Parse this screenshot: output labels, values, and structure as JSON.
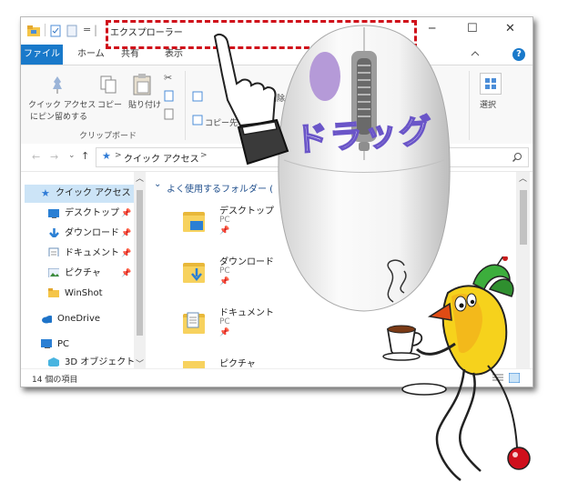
{
  "window": {
    "title": "エクスプローラー",
    "controls": {
      "minimize": "─",
      "maximize": "☐",
      "close": "✕"
    }
  },
  "quick_access_toolbar": {
    "dropdown": "="
  },
  "ribbon": {
    "tabs": [
      {
        "label": "ファイル"
      },
      {
        "label": "ホーム"
      },
      {
        "label": "共有"
      },
      {
        "label": "表示"
      }
    ],
    "help": "?",
    "clipboard": {
      "pin_label_1": "クイック アクセス",
      "pin_label_2": "にピン留めする",
      "copy_label": "コピー",
      "paste_label": "貼り付け",
      "group_label": "クリップボード"
    },
    "organize": {
      "delete_label": "削除",
      "copy_to_label": "コピー先"
    },
    "select_label": "選択"
  },
  "address_bar": {
    "path_root": "クイック アクセス",
    "separator": ">",
    "search_icon": "search-icon"
  },
  "nav_pane": {
    "items": [
      {
        "label": "クイック アクセス",
        "icon": "star-icon",
        "pinned": false
      },
      {
        "label": "デスクトップ",
        "icon": "desktop-icon",
        "pinned": true
      },
      {
        "label": "ダウンロード",
        "icon": "download-icon",
        "pinned": true
      },
      {
        "label": "ドキュメント",
        "icon": "document-icon",
        "pinned": true
      },
      {
        "label": "ピクチャ",
        "icon": "pictures-icon",
        "pinned": true
      },
      {
        "label": "WinShot",
        "icon": "folder-icon",
        "pinned": false
      },
      {
        "label": "OneDrive",
        "icon": "cloud-icon",
        "pinned": false
      },
      {
        "label": "PC",
        "icon": "pc-icon",
        "pinned": false
      },
      {
        "label": "3D オブジェクト",
        "icon": "cube-icon",
        "pinned": false
      }
    ],
    "pin_glyph": "📌"
  },
  "content": {
    "section_header": "よく使用するフォルダー (",
    "folders": [
      {
        "name": "デスクトップ",
        "location": "PC"
      },
      {
        "name": "ダウンロード",
        "location": "PC"
      },
      {
        "name": "ドキュメント",
        "location": "PC"
      },
      {
        "name": "ピクチャ",
        "location": ""
      }
    ]
  },
  "status_bar": {
    "item_count": "14 個の項目"
  },
  "overlay": {
    "drag_label": "ドラッグ"
  },
  "colors": {
    "accent": "#1979ca",
    "dash_box": "#d0101a",
    "mouse_button": "#b59ad8",
    "drag_text_stroke": "#6a55c8"
  }
}
